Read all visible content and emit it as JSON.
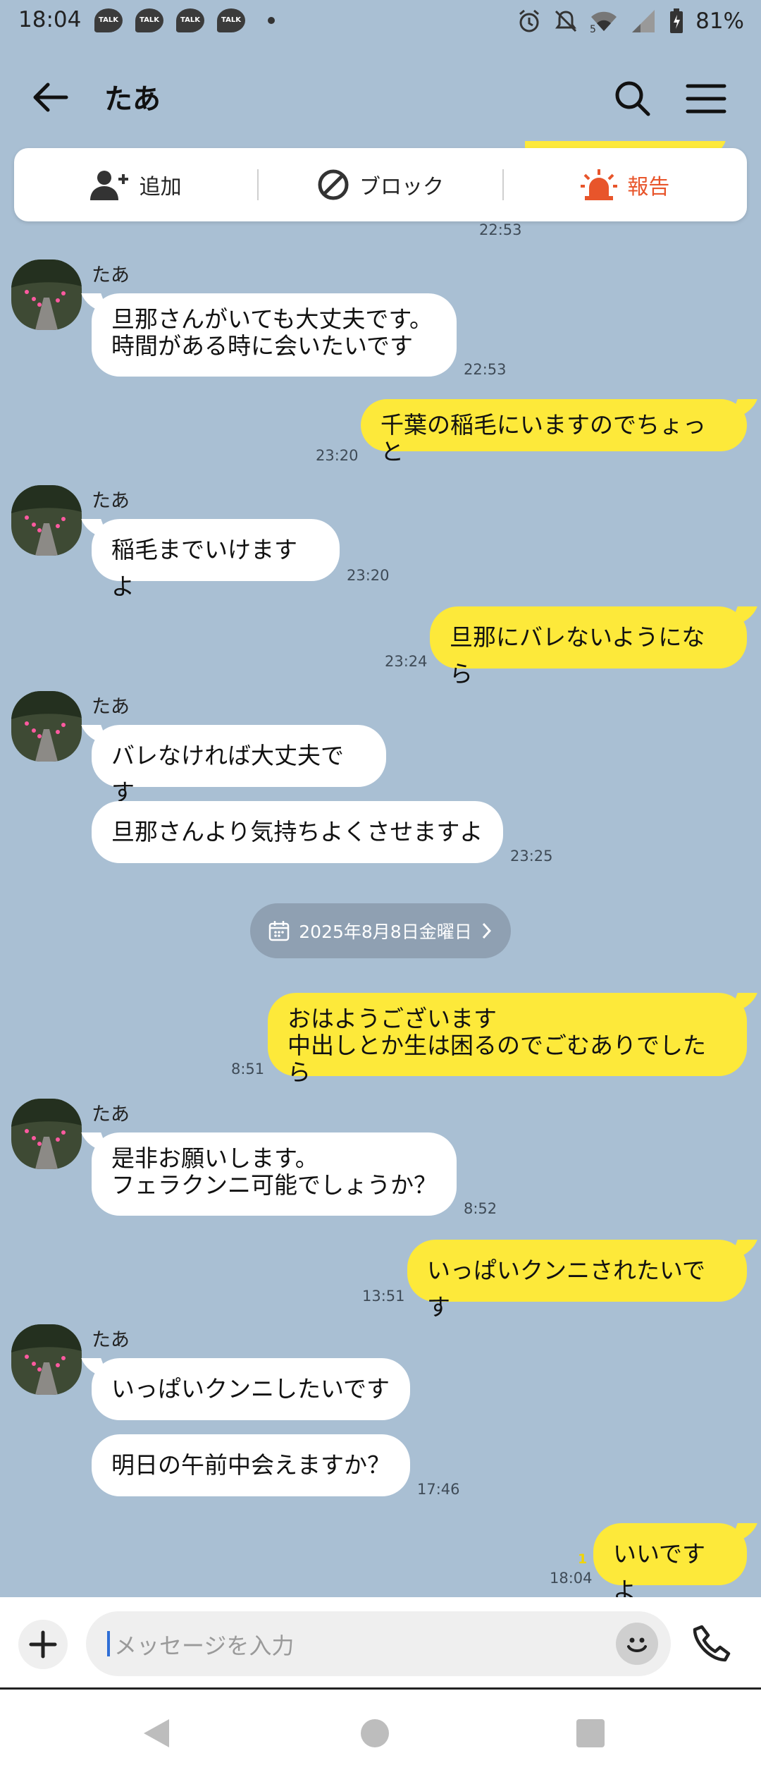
{
  "status_bar": {
    "time": "18:04",
    "notification_badges": [
      "TALK",
      "TALK",
      "TALK",
      "TALK"
    ],
    "battery": "81%",
    "network": "5",
    "icons": [
      "alarm-icon",
      "mute-icon",
      "wifi-icon",
      "signal-icon",
      "battery-icon"
    ]
  },
  "header": {
    "title": "たあ"
  },
  "actions": {
    "add": "追加",
    "block": "ブロック",
    "report": "報告"
  },
  "colors": {
    "background": "#a9bfd3",
    "outgoing_bubble": "#fde93a",
    "incoming_bubble": "#ffffff",
    "report": "#e8552b"
  },
  "messages": [
    {
      "side": "out",
      "text": "",
      "time": "22:53"
    },
    {
      "side": "in",
      "sender": "たあ",
      "text": "旦那さんがいても大丈夫です。\n時間がある時に会いたいです",
      "time": "22:53"
    },
    {
      "side": "out",
      "text": "千葉の稲毛にいますのでちょっと",
      "time": "23:20"
    },
    {
      "side": "in",
      "sender": "たあ",
      "text": "稲毛までいけますよ",
      "time": "23:20"
    },
    {
      "side": "out",
      "text": "旦那にバレないようになら",
      "time": "23:24"
    },
    {
      "side": "in",
      "sender": "たあ",
      "text": "バレなければ大丈夫です"
    },
    {
      "side": "in",
      "text": "旦那さんより気持ちよくさせますよ",
      "time": "23:25"
    },
    {
      "side": "out",
      "text": "おはようございます\n中出しとか生は困るのでごむありでしたら",
      "time": "8:51"
    },
    {
      "side": "in",
      "sender": "たあ",
      "text": "是非お願いします。\nフェラクンニ可能でしょうか？",
      "time": "8:52"
    },
    {
      "side": "out",
      "text": "いっぱいクンニされたいです",
      "time": "13:51"
    },
    {
      "side": "in",
      "sender": "たあ",
      "text": "いっぱいクンニしたいです"
    },
    {
      "side": "in",
      "text": "明日の午前中会えますか？",
      "time": "17:46"
    },
    {
      "side": "out",
      "text": "いいですよ",
      "time": "18:04",
      "read": "1"
    }
  ],
  "date_separator": "2025年8月8日金曜日",
  "input": {
    "placeholder": "メッセージを入力"
  }
}
